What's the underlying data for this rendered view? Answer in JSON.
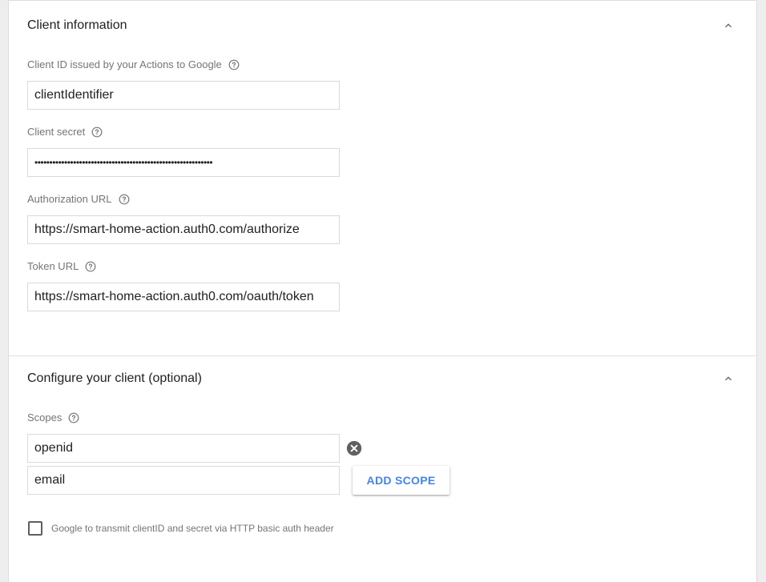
{
  "client_information": {
    "title": "Client information",
    "client_id": {
      "label": "Client ID issued by your Actions to Google",
      "value": "clientIdentifier"
    },
    "client_secret": {
      "label": "Client secret",
      "value": "••••••••••••••••••••••••••••••••••••••••••••••••••••••••••••"
    },
    "authorization_url": {
      "label": "Authorization URL",
      "value": "https://smart-home-action.auth0.com/authorize"
    },
    "token_url": {
      "label": "Token URL",
      "value": "https://smart-home-action.auth0.com/oauth/token"
    }
  },
  "configure_client": {
    "title": "Configure your client (optional)",
    "scopes_label": "Scopes",
    "scopes": [
      "openid",
      "email"
    ],
    "add_scope_label": "ADD SCOPE",
    "basic_auth_label": "Google to transmit clientID and secret via HTTP basic auth header",
    "basic_auth_checked": false
  },
  "icons": {
    "collapse": "chevron-up-icon",
    "help": "help-circle-icon",
    "remove": "cancel-circle-icon"
  },
  "colors": {
    "accent": "#4285f4",
    "label": "#757575",
    "text": "#212121"
  }
}
